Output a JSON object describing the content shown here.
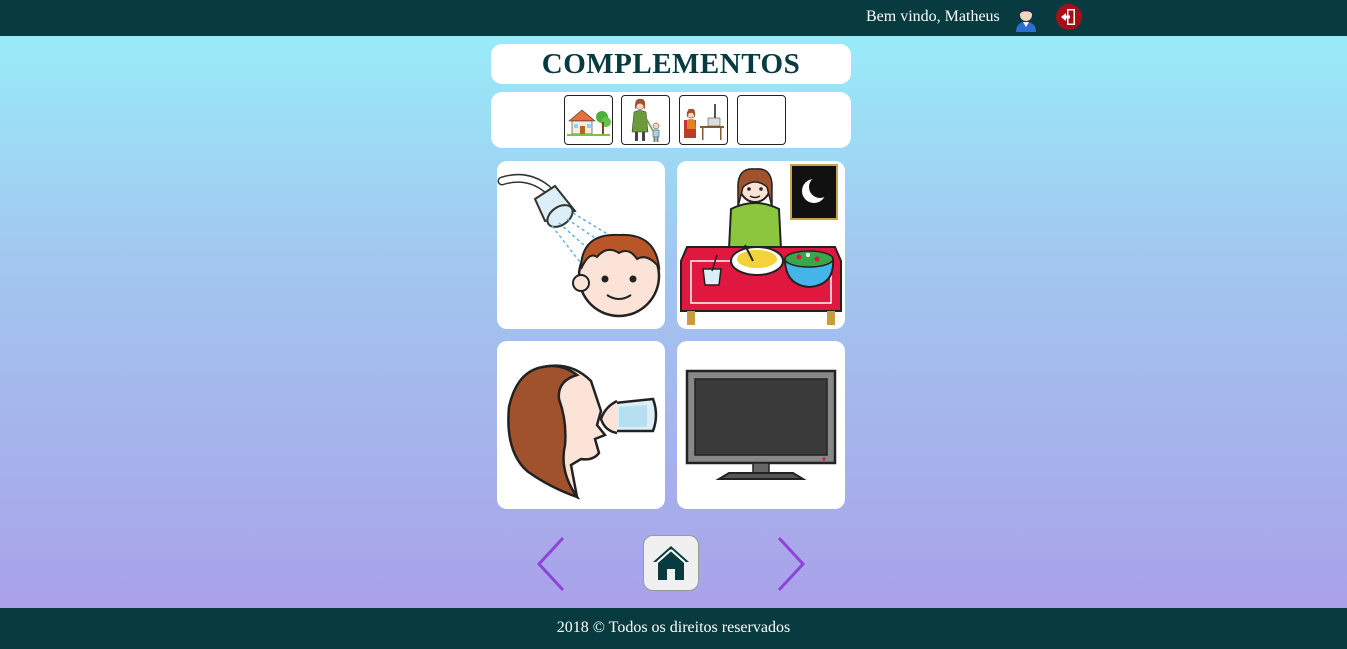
{
  "header": {
    "welcome_text": "Bem vindo, Matheus",
    "user_icon": "user-avatar-icon",
    "logout_icon": "logout-door-icon",
    "background_color": "#083b40",
    "logout_color": "#a50f17"
  },
  "page": {
    "title": "COMPLEMENTOS"
  },
  "sequence": {
    "slots": [
      {
        "icon": "house-icon"
      },
      {
        "icon": "mother-child-icon"
      },
      {
        "icon": "woman-at-desk-icon"
      },
      {
        "icon": "empty-slot"
      }
    ]
  },
  "options": [
    {
      "icon": "shower-head-icon"
    },
    {
      "icon": "dinner-icon"
    },
    {
      "icon": "drink-water-icon"
    },
    {
      "icon": "television-icon"
    }
  ],
  "navigation": {
    "prev_icon": "chevron-left-icon",
    "home_icon": "home-icon",
    "next_icon": "chevron-right-icon",
    "arrow_color": "#8e44d6"
  },
  "footer": {
    "text": "2018 © Todos os direitos reservados"
  }
}
